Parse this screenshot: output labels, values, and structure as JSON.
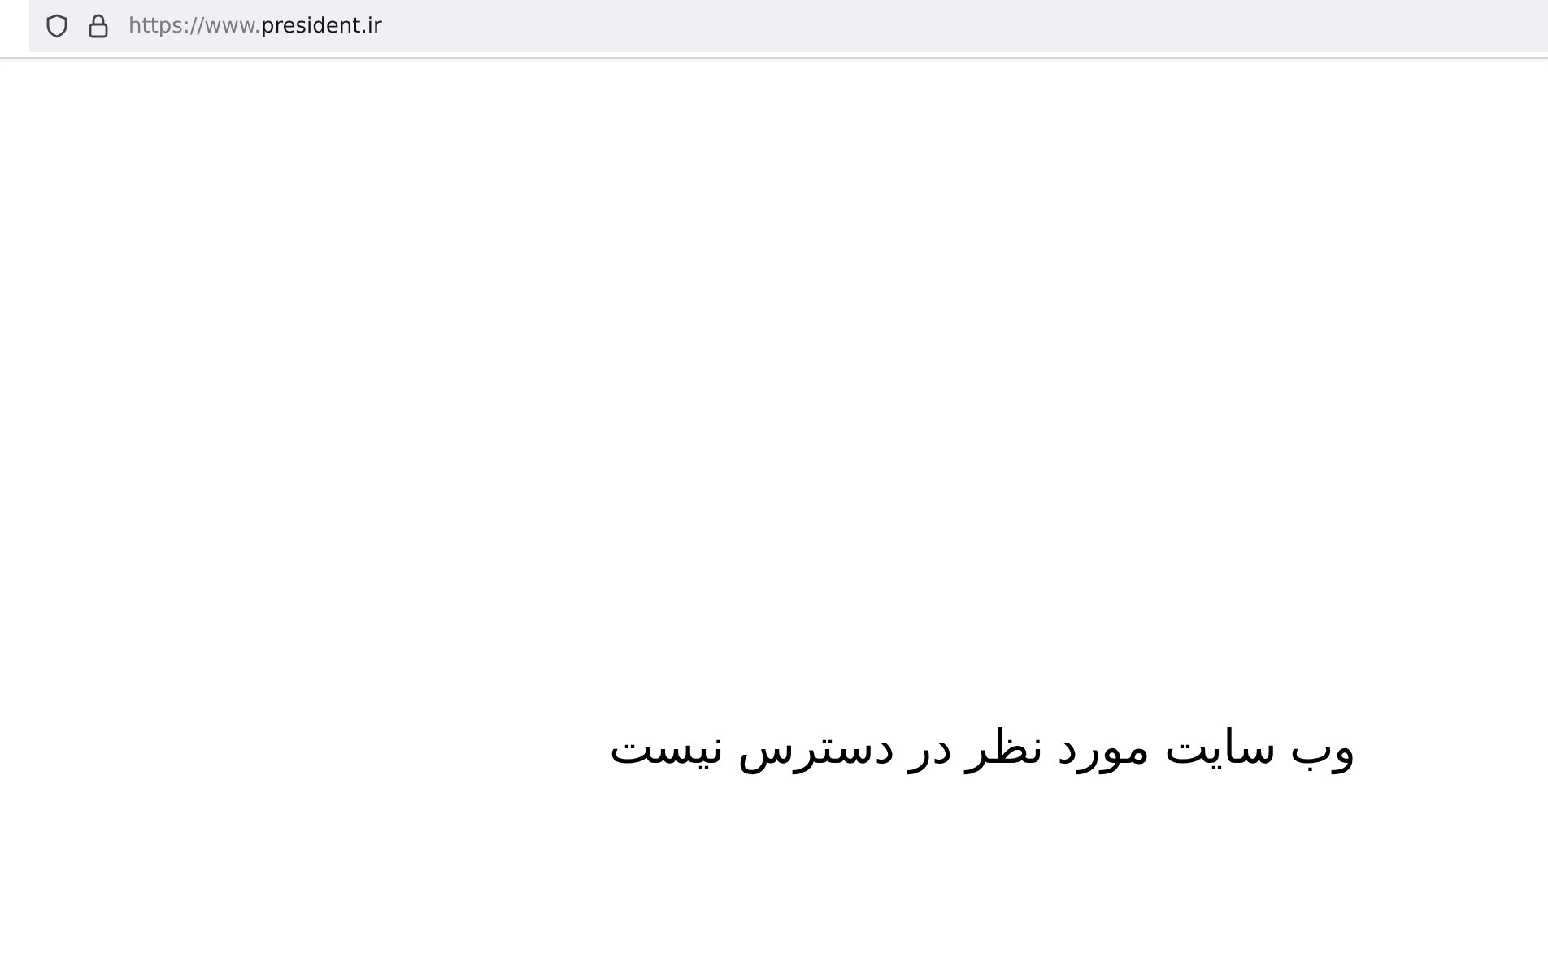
{
  "address_bar": {
    "url_prefix": "https://www.",
    "url_domain": "president.ir"
  },
  "message": "وب سایت مورد نظر در دسترس نیست"
}
